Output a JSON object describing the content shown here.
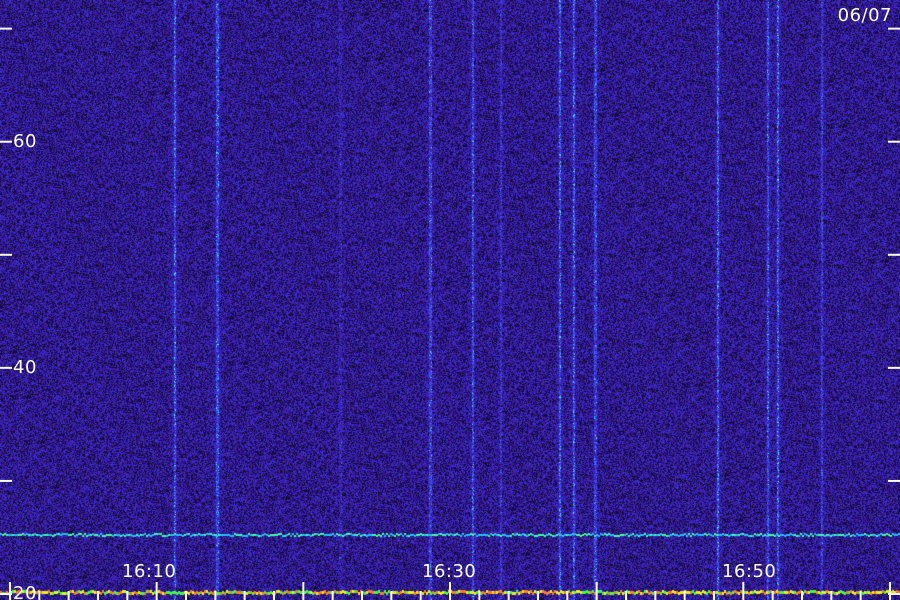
{
  "chart_data": {
    "type": "heatmap",
    "date_label": "06/07",
    "x_tick_labels": [
      "16:10",
      "16:30",
      "16:50"
    ],
    "y_tick_labels": [
      "60",
      "40",
      "20"
    ],
    "y_range": [
      20,
      72
    ],
    "y_major_ticks": [
      20,
      30,
      40,
      50,
      60,
      70
    ],
    "x_minor_ticks": 30,
    "bands": [
      {
        "y": 20.2,
        "intensity": "high",
        "colors": [
          "#ff8020",
          "#f0f020",
          "#40ff40"
        ]
      },
      {
        "y": 25.2,
        "intensity": "medium",
        "colors": [
          "#20c0ff",
          "#40ffa0"
        ]
      }
    ],
    "vertical_streaks": [
      {
        "x": 0.194,
        "strength": 0.9
      },
      {
        "x": 0.241,
        "strength": 0.8
      },
      {
        "x": 0.378,
        "strength": 0.3
      },
      {
        "x": 0.478,
        "strength": 0.7
      },
      {
        "x": 0.525,
        "strength": 0.8
      },
      {
        "x": 0.556,
        "strength": 0.5
      },
      {
        "x": 0.622,
        "strength": 0.9
      },
      {
        "x": 0.637,
        "strength": 0.9
      },
      {
        "x": 0.661,
        "strength": 0.7
      },
      {
        "x": 0.797,
        "strength": 0.9
      },
      {
        "x": 0.853,
        "strength": 0.8
      },
      {
        "x": 0.864,
        "strength": 0.9
      },
      {
        "x": 0.913,
        "strength": 0.6
      }
    ],
    "palette": {
      "background": "#1a0b4a",
      "low": "#3d1fb0",
      "mid": "#4060ff",
      "high": "#40ffff"
    }
  }
}
